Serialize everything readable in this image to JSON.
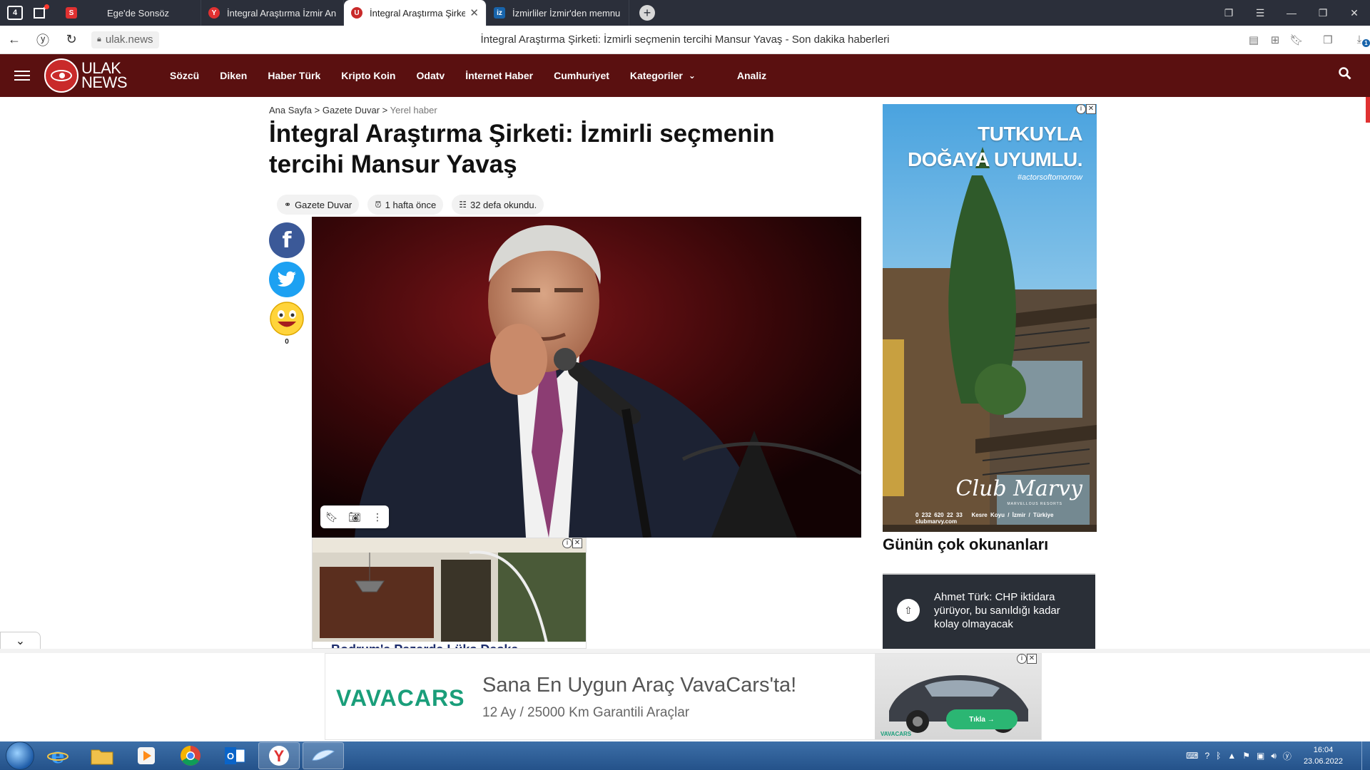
{
  "browser": {
    "tab_counter": "4",
    "tabs": [
      {
        "title": "Ege'de Sonsöz",
        "favicon_letter": "S",
        "favicon_color": "#e03131"
      },
      {
        "title": "İntegral Araştırma İzmir An",
        "favicon_letter": "Y",
        "favicon_color": "#e03131"
      },
      {
        "title": "İntegral Araştırma Şirketi",
        "favicon_letter": "U",
        "favicon_color": "#c92a2a"
      },
      {
        "title": "İzmirliler İzmir'den memnu",
        "favicon_letter": "iz",
        "favicon_color": "#1864ab"
      }
    ],
    "active_tab_index": 2,
    "url": "ulak.news",
    "page_title": "İntegral Araştırma Şirketi: İzmirli seçmenin tercihi Mansur Yavaş - Son dakika haberleri",
    "download_badge": "1"
  },
  "site": {
    "logo_line1": "ULAK",
    "logo_line2": "NEWS",
    "nav": [
      "Sözcü",
      "Diken",
      "Haber Türk",
      "Kripto Koin",
      "Odatv",
      "İnternet Haber",
      "Cumhuriyet",
      "Kategoriler",
      "Analiz"
    ],
    "brand_color": "#5a1010"
  },
  "breadcrumb": {
    "home": "Ana Sayfa",
    "section": "Gazete Duvar",
    "current": "Yerel haber",
    "separator": ">"
  },
  "article": {
    "title": "İntegral Araştırma Şirketi: İzmirli seçmenin tercihi Mansur Yavaş",
    "source": "Gazete Duvar",
    "time": "1 hafta önce",
    "reads": "32 defa okundu.",
    "emoji_count": "0"
  },
  "sidebar": {
    "ad_headline_1": "TUTKUYLA",
    "ad_headline_2": "DOĞAYA UYUMLU.",
    "ad_hashtag": "#actorsoftomorrow",
    "ad_brand": "Club Marvy",
    "ad_brand_sub": "MARVELLOUS RESORTS",
    "ad_phone": "0 232 620 22 33",
    "ad_address": "Kesre Koyu / İzmir / Türkiye",
    "ad_web": "clubmarvy.com",
    "most_read_title": "Günün çok okunanları",
    "most_read_item": "Ahmet Türk: CHP iktidara yürüyor, bu sanıldığı kadar kolay olmayacak"
  },
  "inline_ad": {
    "caption": "Bodrum'a Pazarda Lüks Daska"
  },
  "bottom_ad": {
    "logo": "VAVACARS",
    "headline": "Sana En Uygun Araç VavaCars'ta!",
    "subline": "12 Ay / 25000 Km Garantili Araçlar",
    "button": "Tıkla →",
    "small_logo": "VAVACARS",
    "accent": "#1a9e7a"
  },
  "taskbar": {
    "time": "16:04",
    "date": "23.06.2022"
  }
}
